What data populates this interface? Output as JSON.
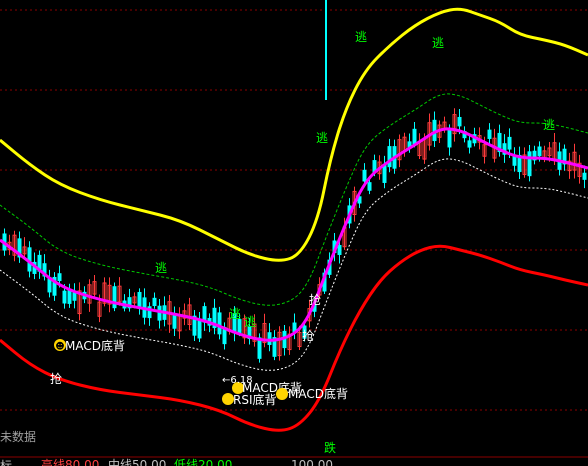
{
  "chart_data": {
    "type": "line",
    "grid": true,
    "colors": {
      "background": "#000000",
      "grid": "#8B0000",
      "upper": "#FFFF00",
      "middle": "#FF00FF",
      "lower": "#FF0000",
      "candle_up": "#FF3B3B",
      "candle_down": "#00FFFF",
      "inner_band": "#FFFFFF",
      "outer_band": "#00C800",
      "signal_green": "#00FF00",
      "signal_white": "#FFFFFF",
      "badge": "#FFD400"
    },
    "series": [
      {
        "name": "高线",
        "values": [
          80.0
        ]
      },
      {
        "name": "中线",
        "values": [
          50.0
        ]
      },
      {
        "name": "低线",
        "values": [
          20.0
        ]
      }
    ],
    "signals": {
      "escape": "逃",
      "grab": "抢",
      "fall": "跌"
    },
    "annotations": {
      "macd_divergence_1": "MACD底背",
      "macd_divergence_2": "MACD底背",
      "macd_divergence_3": "MACD底背",
      "rsi_divergence": "RSI底背",
      "low_price": "←6.18"
    },
    "footer": {
      "left_text": "未数据",
      "bottom_fragment": "标",
      "scale_value": "100.00"
    }
  }
}
